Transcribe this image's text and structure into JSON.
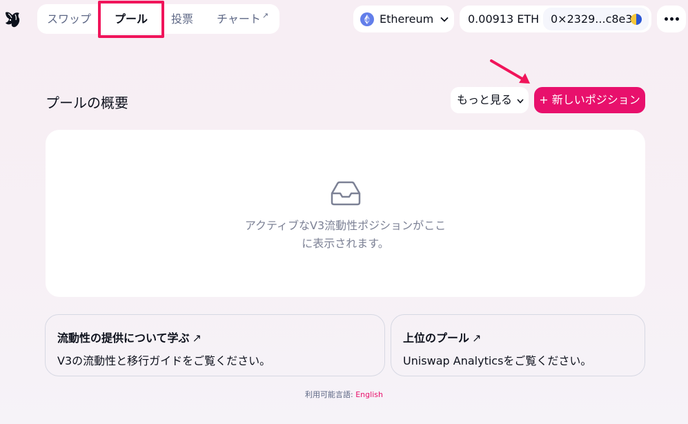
{
  "nav": {
    "items": [
      {
        "label": "スワップ",
        "active": false
      },
      {
        "label": "プール",
        "active": true
      },
      {
        "label": "投票",
        "active": false
      },
      {
        "label": "チャート",
        "active": false,
        "external": true
      }
    ],
    "external_mark": "↗"
  },
  "network": {
    "label": "Ethereum",
    "icon": "ethereum-icon"
  },
  "account": {
    "balance": "0.00913 ETH",
    "address": "0×2329...c8e3"
  },
  "page": {
    "title": "プールの概要",
    "more_label": "もっと見る",
    "new_position_label": "+ 新しいポジション"
  },
  "empty_state": {
    "line1": "アクティブなV3流動性ポジションがここ",
    "line2": "に表示されます。",
    "icon": "inbox-icon"
  },
  "info_cards": [
    {
      "title": "流動性の提供について学ぶ",
      "arrow": "↗",
      "subtitle": "V3の流動性と移行ガイドをご覧ください。"
    },
    {
      "title": "上位のプール",
      "arrow": "↗",
      "subtitle": "Uniswap Analyticsをご覧ください。"
    }
  ],
  "footer": {
    "prefix": "利用可能言語: ",
    "language": "English"
  },
  "colors": {
    "accent": "#e8106c",
    "highlight": "#f0145a",
    "text": "#0d111c",
    "muted": "#5d6785"
  }
}
